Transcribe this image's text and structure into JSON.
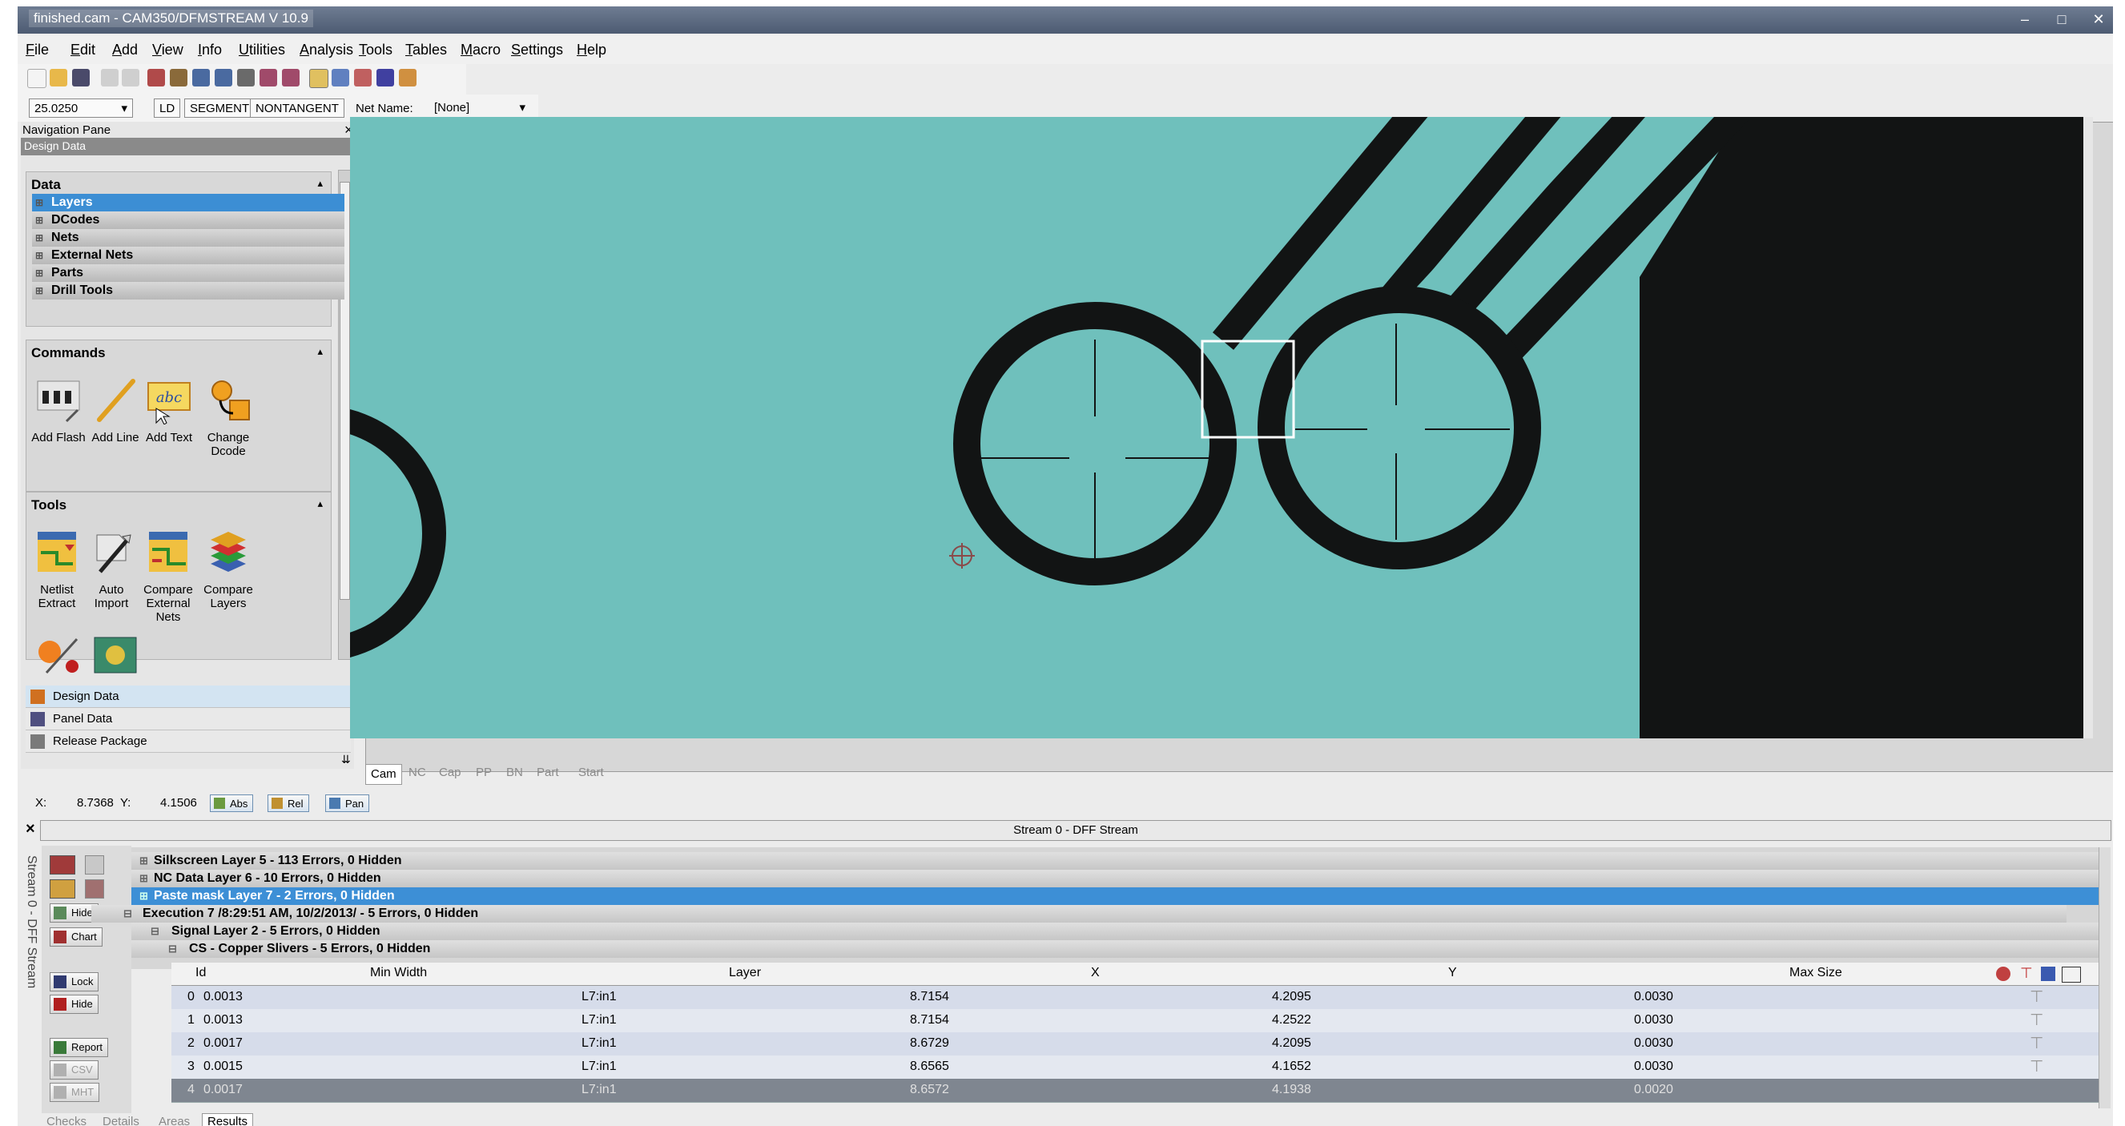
{
  "window": {
    "title": "finished.cam - CAM350/DFMSTREAM V 10.9",
    "min_glyph": "–",
    "max_glyph": "□",
    "close_glyph": "✕"
  },
  "menu": [
    "File",
    "Edit",
    "Add",
    "View",
    "Info",
    "Utilities",
    "Analysis",
    "Tools",
    "Tables",
    "Macro",
    "Settings",
    "Help"
  ],
  "toolbar2": {
    "width_value": "25.0250",
    "btn_ld": "LD",
    "btn_segment": "SEGMENT",
    "btn_nontangent": "NONTANGENT",
    "net_name_label": "Net Name:",
    "net_name_value": "[None]"
  },
  "nav": {
    "pane_title": "Navigation Pane",
    "subheader": "Design Data",
    "data_title": "Data",
    "data_items": [
      "Layers",
      "DCodes",
      "Nets",
      "External Nets",
      "Parts",
      "Drill Tools"
    ],
    "selected_data_item": "Layers",
    "commands_title": "Commands",
    "commands": [
      "Add Flash",
      "Add Line",
      "Add Text",
      "Change Dcode"
    ],
    "tools_title": "Tools",
    "tools": [
      "Netlist Extract",
      "Auto Import",
      "Compare External Nets",
      "Compare Layers"
    ],
    "bottom_items": [
      "Design Data",
      "Panel Data",
      "Release Package"
    ]
  },
  "cam_tabs": [
    "Cam",
    "NC",
    "Cap",
    "PP",
    "BN",
    "Part",
    "Start"
  ],
  "coords": {
    "x_label": "X:",
    "x_value": "8.7368",
    "y_label": "Y:",
    "y_value": "4.1506",
    "btn_abs": "Abs",
    "btn_rel": "Rel",
    "btn_pan": "Pan"
  },
  "stream": {
    "header": "Stream 0 - DFF Stream",
    "vertical_label": "Stream 0 - DFF Stream",
    "left_buttons": [
      "Hide",
      "Chart",
      "Lock",
      "Hide",
      "Report",
      "CSV",
      "MHT"
    ],
    "groups": [
      "Silkscreen Layer 5 - 113 Errors, 0 Hidden",
      "NC Data Layer 6 - 10 Errors, 0 Hidden",
      "Paste mask Layer 7 - 2 Errors, 0 Hidden",
      "Execution 7 /8:29:51 AM, 10/2/2013/ - 5 Errors, 0 Hidden",
      "Signal Layer 2 - 5 Errors, 0 Hidden",
      "CS - Copper Slivers - 5 Errors, 0 Hidden"
    ],
    "columns": [
      "Id",
      "Min Width",
      "Layer",
      "X",
      "Y",
      "Max Size"
    ],
    "rows": [
      {
        "id": "0",
        "min_width": "0.0013",
        "layer": "L7:in1",
        "x": "8.7154",
        "y": "4.2095",
        "max_size": "0.0030"
      },
      {
        "id": "1",
        "min_width": "0.0013",
        "layer": "L7:in1",
        "x": "8.7154",
        "y": "4.2522",
        "max_size": "0.0030"
      },
      {
        "id": "2",
        "min_width": "0.0017",
        "layer": "L7:in1",
        "x": "8.6729",
        "y": "4.2095",
        "max_size": "0.0030"
      },
      {
        "id": "3",
        "min_width": "0.0015",
        "layer": "L7:in1",
        "x": "8.6565",
        "y": "4.1652",
        "max_size": "0.0030"
      },
      {
        "id": "4",
        "min_width": "0.0017",
        "layer": "L7:in1",
        "x": "8.6572",
        "y": "4.1938",
        "max_size": "0.0020"
      }
    ],
    "bottom_tabs": [
      "Checks",
      "Details",
      "Areas",
      "Results"
    ]
  },
  "colors": {
    "canvas_bg": "#6fc0bc",
    "trace": "#121414",
    "selection": "#3c8ed4"
  }
}
